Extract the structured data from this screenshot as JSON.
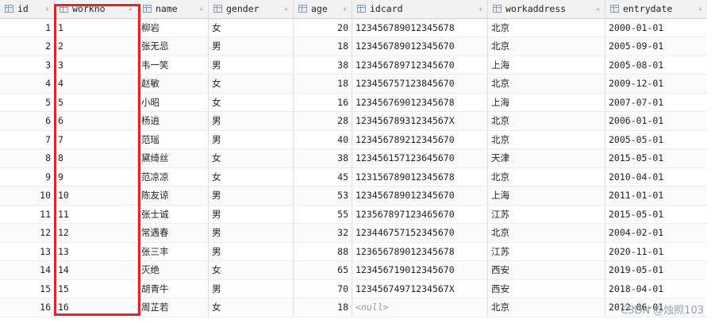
{
  "columns": [
    {
      "label": "id",
      "key": "id"
    },
    {
      "label": "workno",
      "key": "workno"
    },
    {
      "label": "name",
      "key": "name"
    },
    {
      "label": "gender",
      "key": "gender"
    },
    {
      "label": "age",
      "key": "age"
    },
    {
      "label": "idcard",
      "key": "idcard"
    },
    {
      "label": "workaddress",
      "key": "workaddress"
    },
    {
      "label": "entrydate",
      "key": "entrydate"
    }
  ],
  "rows": [
    {
      "id": "1",
      "workno": "1",
      "name": "柳岩",
      "gender": "女",
      "age": "20",
      "idcard": "123456789012345678",
      "workaddress": "北京",
      "entrydate": "2000-01-01"
    },
    {
      "id": "2",
      "workno": "2",
      "name": "张无忌",
      "gender": "男",
      "age": "18",
      "idcard": "123456789012345670",
      "workaddress": "北京",
      "entrydate": "2005-09-01"
    },
    {
      "id": "3",
      "workno": "3",
      "name": "韦一笑",
      "gender": "男",
      "age": "38",
      "idcard": "123456789712345670",
      "workaddress": "上海",
      "entrydate": "2005-08-01"
    },
    {
      "id": "4",
      "workno": "4",
      "name": "赵敏",
      "gender": "女",
      "age": "18",
      "idcard": "123456757123845670",
      "workaddress": "北京",
      "entrydate": "2009-12-01"
    },
    {
      "id": "5",
      "workno": "5",
      "name": "小昭",
      "gender": "女",
      "age": "16",
      "idcard": "123456769012345678",
      "workaddress": "上海",
      "entrydate": "2007-07-01"
    },
    {
      "id": "6",
      "workno": "6",
      "name": "杨逍",
      "gender": "男",
      "age": "28",
      "idcard": "12345678931234567X",
      "workaddress": "北京",
      "entrydate": "2006-01-01"
    },
    {
      "id": "7",
      "workno": "7",
      "name": "范瑶",
      "gender": "男",
      "age": "40",
      "idcard": "123456789212345670",
      "workaddress": "北京",
      "entrydate": "2005-05-01"
    },
    {
      "id": "8",
      "workno": "8",
      "name": "黛绮丝",
      "gender": "女",
      "age": "38",
      "idcard": "123456157123645670",
      "workaddress": "天津",
      "entrydate": "2015-05-01"
    },
    {
      "id": "9",
      "workno": "9",
      "name": "范凉凉",
      "gender": "女",
      "age": "45",
      "idcard": "123156789012345678",
      "workaddress": "北京",
      "entrydate": "2010-04-01"
    },
    {
      "id": "10",
      "workno": "10",
      "name": "陈友谅",
      "gender": "男",
      "age": "53",
      "idcard": "123456789012345670",
      "workaddress": "上海",
      "entrydate": "2011-01-01"
    },
    {
      "id": "11",
      "workno": "11",
      "name": "张士诚",
      "gender": "男",
      "age": "55",
      "idcard": "123567897123465670",
      "workaddress": "江苏",
      "entrydate": "2015-05-01"
    },
    {
      "id": "12",
      "workno": "12",
      "name": "常遇春",
      "gender": "男",
      "age": "32",
      "idcard": "123446757152345670",
      "workaddress": "北京",
      "entrydate": "2004-02-01"
    },
    {
      "id": "13",
      "workno": "13",
      "name": "张三丰",
      "gender": "男",
      "age": "88",
      "idcard": "123656789012345678",
      "workaddress": "江苏",
      "entrydate": "2020-11-01"
    },
    {
      "id": "14",
      "workno": "14",
      "name": "灭绝",
      "gender": "女",
      "age": "65",
      "idcard": "123456719012345670",
      "workaddress": "西安",
      "entrydate": "2019-05-01"
    },
    {
      "id": "15",
      "workno": "15",
      "name": "胡青牛",
      "gender": "男",
      "age": "70",
      "idcard": "12345674971234567X",
      "workaddress": "西安",
      "entrydate": "2018-04-01"
    },
    {
      "id": "16",
      "workno": "16",
      "name": "周芷若",
      "gender": "女",
      "age": "18",
      "idcard": "<null>",
      "workaddress": "北京",
      "entrydate": "2012-06-01"
    }
  ],
  "sort_glyph": "÷",
  "watermark": "CSDN @烛照103",
  "colors": {
    "highlight_border": "#e0242c",
    "null_text": "#9a9a9a"
  },
  "icons": {
    "column": "column-icon",
    "sort": "sort-icon"
  }
}
